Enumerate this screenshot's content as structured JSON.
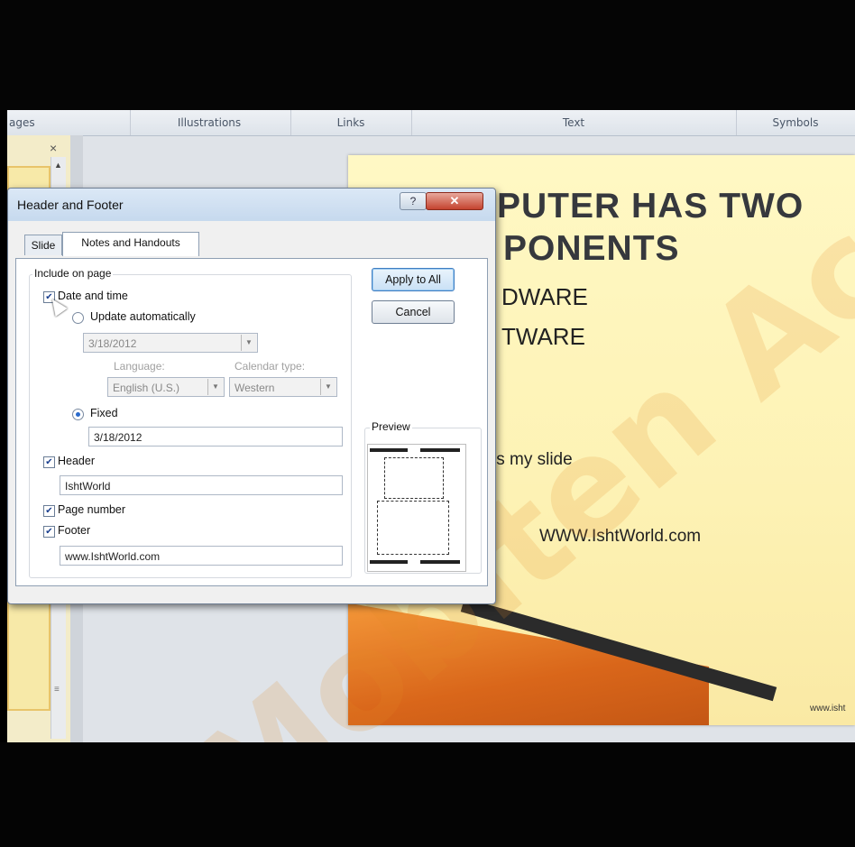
{
  "ribbon": {
    "groups": [
      "ages",
      "Illustrations",
      "Links",
      "Text",
      "Symbols"
    ]
  },
  "slides_pane": {
    "close_glyph": "×",
    "scroll_up_glyph": "▲",
    "scroll_grip_glyph": "≡"
  },
  "slide": {
    "title_line1": "PUTER HAS TWO",
    "title_line2": "PONENTS",
    "bullet1": "DWARE",
    "bullet2": "TWARE",
    "body": "is my slide",
    "footer": "WWW.IshtWorld.com",
    "corner": "www.isht"
  },
  "dialog": {
    "title": "Header and Footer",
    "help_glyph": "?",
    "close_glyph": "✕",
    "tabs": [
      {
        "label": "Slide",
        "active": false
      },
      {
        "label": "Notes and Handouts",
        "active": true
      }
    ],
    "include_on_page": "Include on page",
    "date_and_time": {
      "label": "Date and time",
      "checked": true
    },
    "update_automatically": {
      "label": "Update automatically",
      "selected": false
    },
    "auto_date_value": "3/18/2012",
    "language_label": "Language:",
    "language_value": "English (U.S.)",
    "calendar_label": "Calendar type:",
    "calendar_value": "Western",
    "fixed": {
      "label": "Fixed",
      "selected": true
    },
    "fixed_value": "3/18/2012",
    "header": {
      "label": "Header",
      "checked": true,
      "value": "IshtWorld"
    },
    "page_number": {
      "label": "Page number",
      "checked": true
    },
    "footer": {
      "label": "Footer",
      "checked": true,
      "value": "www.IshtWorld.com"
    },
    "apply_to_all": "Apply to All",
    "cancel": "Cancel",
    "preview_label": "Preview"
  },
  "watermark": "Mobiten Aca",
  "colors": {
    "slide_bg": "#fff8c4",
    "accent_orange": "#d9661a",
    "dialog_bg": "#f0f0f0",
    "close_red": "#c4432f"
  }
}
